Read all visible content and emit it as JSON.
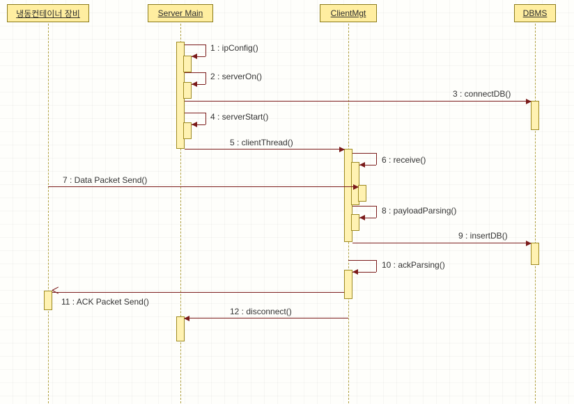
{
  "participants": {
    "p1": "냉동컨테이너 장비",
    "p2": "Server Main",
    "p3": "ClientMgt",
    "p4": "DBMS"
  },
  "messages": {
    "m1": "1 : ipConfig()",
    "m2": "2 : serverOn()",
    "m3": "3 : connectDB()",
    "m4": "4 : serverStart()",
    "m5": "5 : clientThread()",
    "m6": "6 : receive()",
    "m7": "7 : Data Packet Send()",
    "m8": "8 : payloadParsing()",
    "m9": "9 : insertDB()",
    "m10": "10 : ackParsing()",
    "m11": "11 : ACK Packet Send()",
    "m12": "12 : disconnect()"
  },
  "chart_data": {
    "type": "table",
    "description": "UML sequence diagram",
    "participants": [
      "냉동컨테이너 장비",
      "Server Main",
      "ClientMgt",
      "DBMS"
    ],
    "messages": [
      {
        "seq": 1,
        "from": "Server Main",
        "to": "Server Main",
        "label": "ipConfig()",
        "kind": "self"
      },
      {
        "seq": 2,
        "from": "Server Main",
        "to": "Server Main",
        "label": "serverOn()",
        "kind": "self"
      },
      {
        "seq": 3,
        "from": "Server Main",
        "to": "DBMS",
        "label": "connectDB()",
        "kind": "sync"
      },
      {
        "seq": 4,
        "from": "Server Main",
        "to": "Server Main",
        "label": "serverStart()",
        "kind": "self"
      },
      {
        "seq": 5,
        "from": "Server Main",
        "to": "ClientMgt",
        "label": "clientThread()",
        "kind": "sync"
      },
      {
        "seq": 6,
        "from": "ClientMgt",
        "to": "ClientMgt",
        "label": "receive()",
        "kind": "self"
      },
      {
        "seq": 7,
        "from": "냉동컨테이너 장비",
        "to": "ClientMgt",
        "label": "Data Packet Send()",
        "kind": "sync"
      },
      {
        "seq": 8,
        "from": "ClientMgt",
        "to": "ClientMgt",
        "label": "payloadParsing()",
        "kind": "self"
      },
      {
        "seq": 9,
        "from": "ClientMgt",
        "to": "DBMS",
        "label": "insertDB()",
        "kind": "sync"
      },
      {
        "seq": 10,
        "from": "ClientMgt",
        "to": "ClientMgt",
        "label": "ackParsing()",
        "kind": "self"
      },
      {
        "seq": 11,
        "from": "ClientMgt",
        "to": "냉동컨테이너 장비",
        "label": "ACK Packet Send()",
        "kind": "async"
      },
      {
        "seq": 12,
        "from": "ClientMgt",
        "to": "Server Main",
        "label": "disconnect()",
        "kind": "sync"
      }
    ]
  }
}
